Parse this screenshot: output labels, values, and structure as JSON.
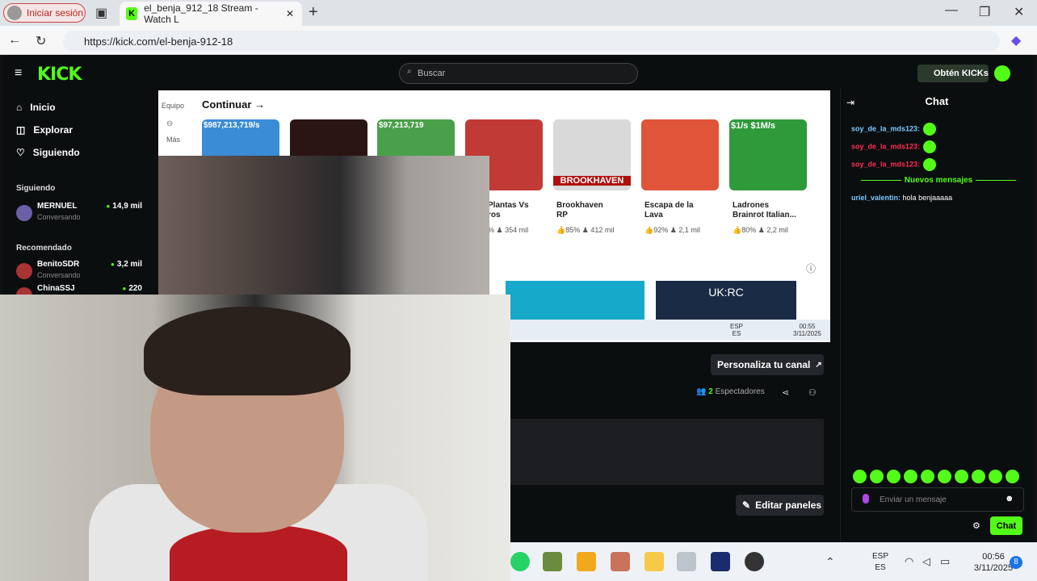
{
  "browser": {
    "profile_label": "Iniciar sesión",
    "tab_title": "el_benja_912_18 Stream - Watch L",
    "url": "https://kick.com/el-benja-912-18"
  },
  "kick": {
    "logo": "KICK",
    "search_placeholder": "Buscar",
    "get_kicks": "Obtén KICKs",
    "nav": [
      {
        "label": "Inicio",
        "icon": "home-icon"
      },
      {
        "label": "Explorar",
        "icon": "compass-icon"
      },
      {
        "label": "Siguiendo",
        "icon": "heart-icon"
      }
    ],
    "following_head": "Siguiendo",
    "following": [
      {
        "name": "MERNUEL",
        "status": "Conversando",
        "viewers": "14,9 mil"
      }
    ],
    "recommended_head": "Recomendado",
    "recommended": [
      {
        "name": "BenitoSDR",
        "status": "Conversando",
        "viewers": "3,2 mil"
      },
      {
        "name": "ChinaSSJ",
        "status": "",
        "viewers": "220"
      }
    ]
  },
  "screen": {
    "side_labels": [
      "Equipo",
      "Más"
    ],
    "continue_heading": "Continuar →",
    "games": [
      {
        "title": "",
        "like": "",
        "players": "",
        "banner": "$987,213,719/s",
        "color": "#3a8cd6"
      },
      {
        "title": "",
        "like": "",
        "players": "",
        "banner": "",
        "color": "#2b1414"
      },
      {
        "title": "",
        "like": "",
        "players": "",
        "banner": "$97,213,719",
        "color": "#4aa04a"
      },
      {
        "title": "Plantas Vs\nros",
        "like": "%",
        "players": "354 mil",
        "banner": "",
        "color": "#c23a36"
      },
      {
        "title": "Brookhaven \nRP",
        "like": "85%",
        "players": "412 mil",
        "banner": "BROOKHAVEN",
        "color": "#d9d9d9"
      },
      {
        "title": "Escapa de la\nLava",
        "like": "92%",
        "players": "2,1 mil",
        "banner": "",
        "color": "#e0543a"
      },
      {
        "title": "Ladrones\nBrainrot Italian...",
        "like": "80%",
        "players": "2,2 mil",
        "banner": "$1/s  $1M/s",
        "color": "#2f9a3a"
      }
    ],
    "tray": {
      "lang1": "ESP",
      "lang2": "ES",
      "time": "00:55",
      "date": "3/11/2025"
    }
  },
  "channel": {
    "customize": "Personaliza tu canal",
    "viewers_count": "2",
    "viewers_label": "Espectadores",
    "edit_panels": "Editar paneles"
  },
  "chat": {
    "title": "Chat",
    "messages": [
      {
        "user": "soy_de_la_mds123:",
        "text": "",
        "color": "#7ec8ff"
      },
      {
        "user": "soy_de_la_mds123:",
        "text": "",
        "color": "#ff2d55"
      },
      {
        "user": "soy_de_la_mds123:",
        "text": "",
        "color": "#ff2d55"
      }
    ],
    "new_messages": "Nuevos mensajes",
    "after": [
      {
        "user": "uriel_valentin:",
        "text": "hola benjaaaaa",
        "color": "#7ec8ff"
      }
    ],
    "input_placeholder": "Enviar un mensaje",
    "send": "Chat"
  },
  "taskbar": {
    "lang1": "ESP",
    "lang2": "ES",
    "time": "00:56",
    "date": "3/11/2025",
    "notifications": "8"
  }
}
